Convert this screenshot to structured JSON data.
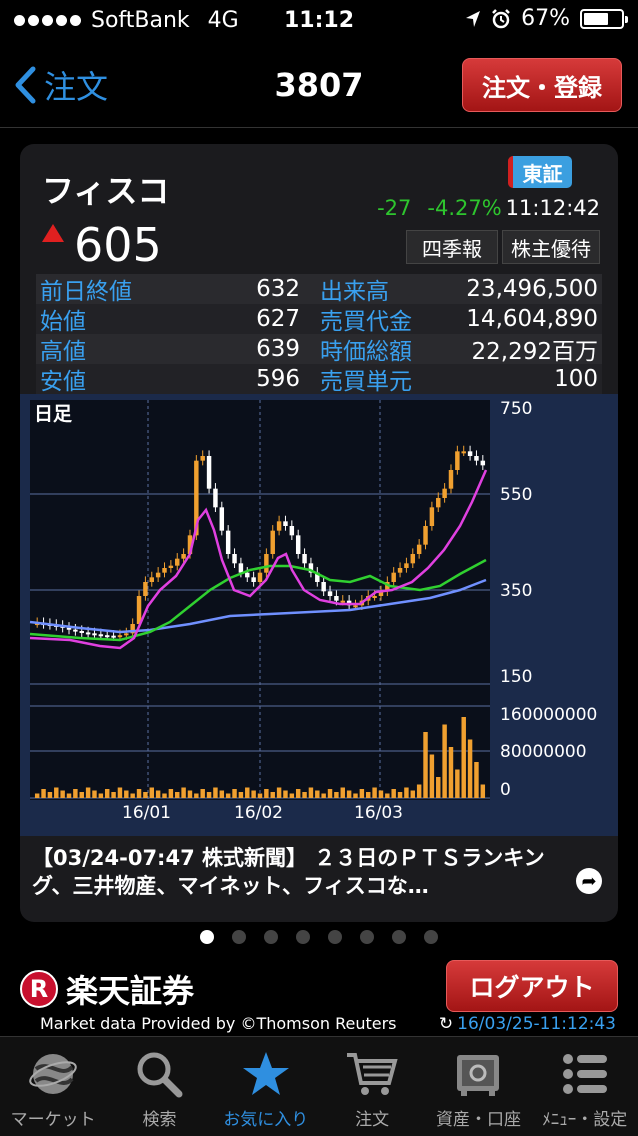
{
  "status_bar": {
    "carrier": "SoftBank",
    "network": "4G",
    "time": "11:12",
    "battery": "67%"
  },
  "nav": {
    "back_label": "注文",
    "title": "3807",
    "order_button": "注文・登録"
  },
  "quote": {
    "name": "フィスコ",
    "exchange": "東証",
    "change": "-27",
    "change_pct": "-4.27%",
    "time": "11:12:42",
    "price": "605",
    "buttons": {
      "quarterly": "四季報",
      "benefits": "株主優待"
    }
  },
  "stats": [
    {
      "label1": "前日終値",
      "value1": "632",
      "label2": "出来高",
      "value2": "23,496,500"
    },
    {
      "label1": "始値",
      "value1": "627",
      "label2": "売買代金",
      "value2": "14,604,890"
    },
    {
      "label1": "高値",
      "value1": "639",
      "label2": "時価総額",
      "value2": "22,292百万"
    },
    {
      "label1": "安値",
      "value1": "596",
      "label2": "売買単元",
      "value2": "100"
    }
  ],
  "chart_data": {
    "type": "candlestick",
    "period_label": "日足",
    "price_axis": {
      "ticks": [
        "750",
        "550",
        "350",
        "150"
      ],
      "ylim": [
        150,
        750
      ]
    },
    "volume_axis": {
      "ticks": [
        "160000000",
        "80000000",
        "0"
      ],
      "ylim": [
        0,
        160000000
      ]
    },
    "x_ticks": [
      "16/01",
      "16/02",
      "16/03"
    ],
    "colors": {
      "up": "#f0a030",
      "down": "#ffffff",
      "ma_short": "#e040e0",
      "ma_mid": "#30d030",
      "ma_long": "#7090ff"
    }
  },
  "news": {
    "text": "【03/24-07:47 株式新聞】 ２３日のＰＴＳランキング、三井物産、マイネット、フィスコな…"
  },
  "pager": {
    "count": 8,
    "active": 0
  },
  "footer": {
    "brand": "楽天証券",
    "brand_logo": "R",
    "logout": "ログアウト",
    "provider": "Market data Provided by ©Thomson Reuters",
    "updated": "16/03/25-11:12:43"
  },
  "tabs": [
    {
      "label": "マーケット",
      "icon": "globe-icon"
    },
    {
      "label": "検索",
      "icon": "search-icon"
    },
    {
      "label": "お気に入り",
      "icon": "star-icon"
    },
    {
      "label": "注文",
      "icon": "cart-icon"
    },
    {
      "label": "資産・口座",
      "icon": "safe-icon"
    },
    {
      "label": "ﾒﾆｭｰ・設定",
      "icon": "menu-icon"
    }
  ]
}
